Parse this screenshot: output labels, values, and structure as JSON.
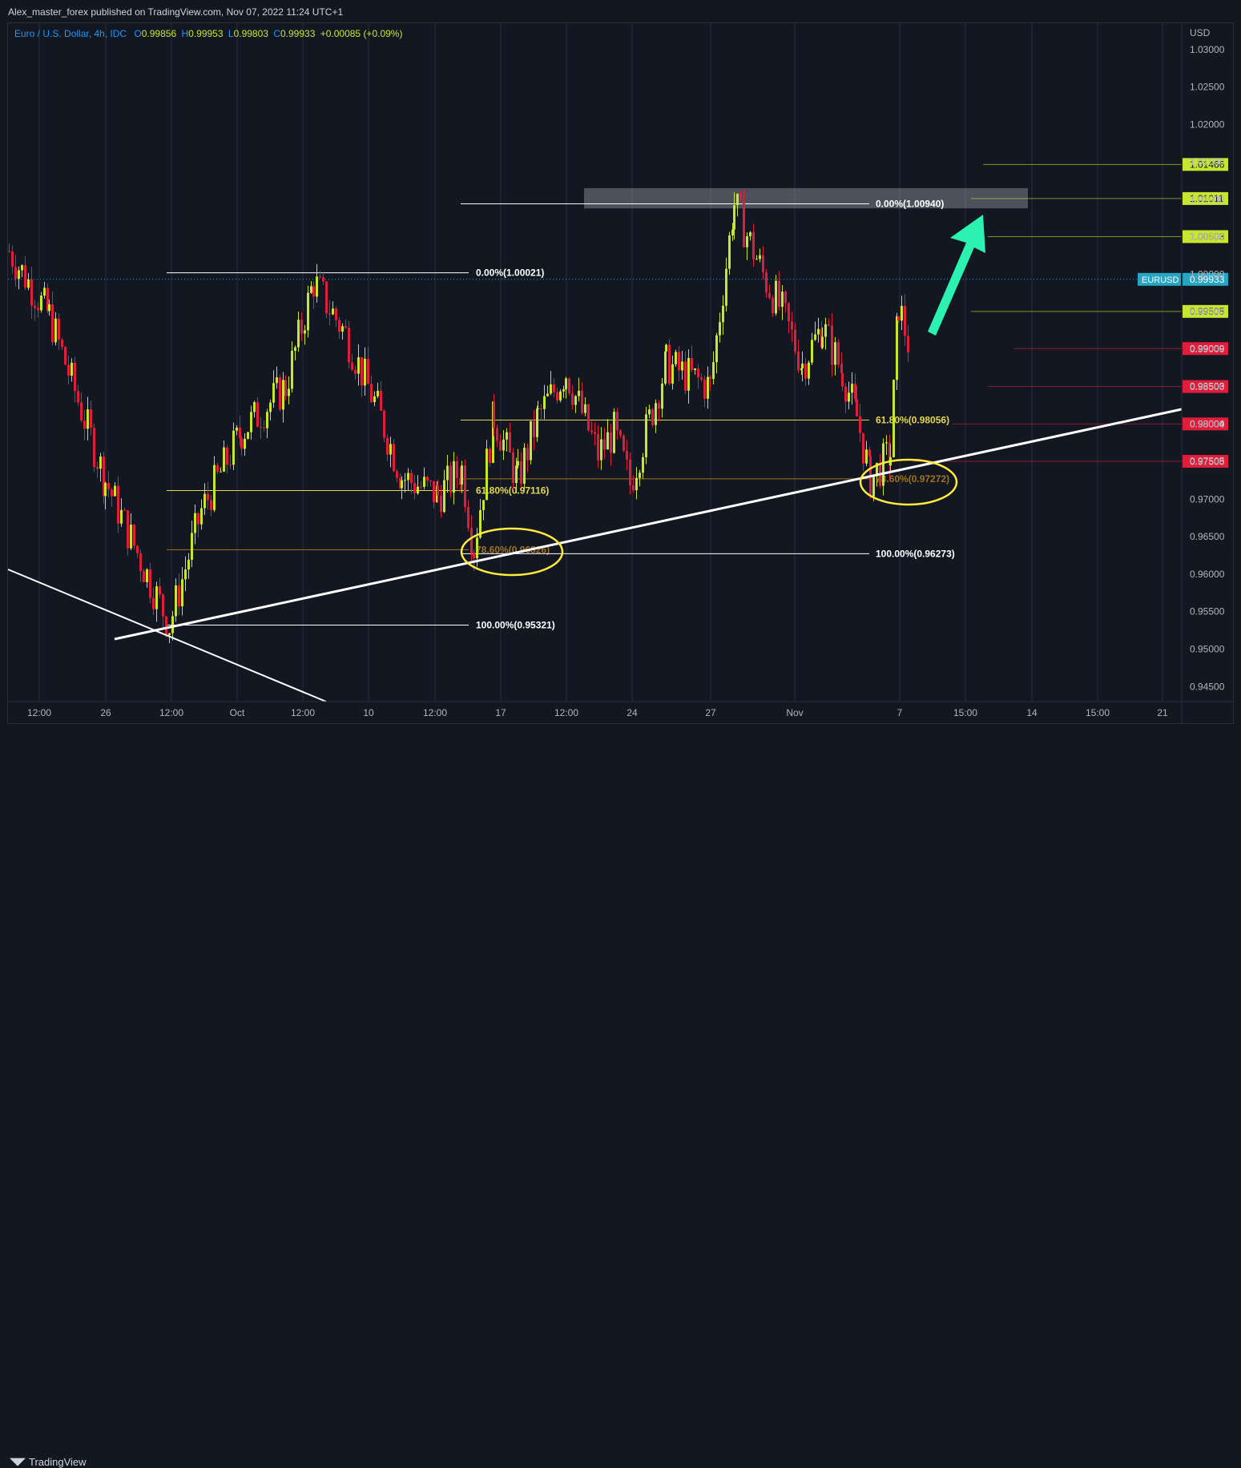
{
  "header": {
    "publisher_line": "Alex_master_forex published on TradingView.com, Nov 07, 2022 11:24 UTC+1"
  },
  "legend": {
    "symbol": "Euro / U.S. Dollar, 4h, IDC",
    "o_label": "O",
    "o_value": "0.99856",
    "h_label": "H",
    "h_value": "0.99953",
    "l_label": "L",
    "l_value": "0.99803",
    "c_label": "C",
    "c_value": "0.99933",
    "change": "+0.00085 (+0.09%)"
  },
  "footer": {
    "brand": "TradingView"
  },
  "colors": {
    "background": "#131722",
    "up": "#c8e62f",
    "down": "#e01e3c",
    "fib_white": "#ffffff",
    "fib_yellow": "#e6d84a",
    "fib_orange": "#a0741e",
    "target_green": "#c8e62f",
    "target_red": "#e01e3c",
    "arrow": "#2bf2b0",
    "last_price_label": "#26a6c2"
  },
  "chart_data": {
    "type": "candlestick",
    "currency_label": "USD",
    "ylim": [
      0.943,
      1.0335
    ],
    "y_ticks": [
      "1.03000",
      "1.02500",
      "1.02000",
      "1.01500",
      "1.01000",
      "1.00500",
      "1.00000",
      "0.99500",
      "0.99000",
      "0.98500",
      "0.98000",
      "0.97500",
      "0.97000",
      "0.96500",
      "0.96000",
      "0.95500",
      "0.95000",
      "0.94500"
    ],
    "x_ticks": [
      "12:00",
      "26",
      "12:00",
      "Oct",
      "12:00",
      "10",
      "12:00",
      "17",
      "12:00",
      "24",
      "27",
      "Nov",
      "7",
      "15:00",
      "14",
      "15:00",
      "21"
    ],
    "last_price": {
      "symbol": "EURUSD",
      "value": "0.99933"
    },
    "price_targets": [
      {
        "label": "1.01466",
        "price": 1.01466,
        "kind": "green"
      },
      {
        "label": "1.01011",
        "price": 1.01011,
        "kind": "green"
      },
      {
        "label": "1.00503",
        "price": 1.00503,
        "kind": "green"
      },
      {
        "label": "0.99505",
        "price": 0.99505,
        "kind": "green"
      },
      {
        "label": "0.99009",
        "price": 0.99009,
        "kind": "red"
      },
      {
        "label": "0.98503",
        "price": 0.98503,
        "kind": "red"
      },
      {
        "label": "0.98004",
        "price": 0.98004,
        "kind": "red"
      },
      {
        "label": "0.97505",
        "price": 0.97505,
        "kind": "red"
      }
    ],
    "fib_levels": [
      {
        "label": "0.00%(1.00021)",
        "price": 1.00021,
        "style": "white"
      },
      {
        "label": "61.80%(0.97116)",
        "price": 0.97116,
        "style": "yellow"
      },
      {
        "label": "78.60%(0.96326)",
        "price": 0.96326,
        "style": "orange"
      },
      {
        "label": "100.00%(0.95321)",
        "price": 0.95321,
        "style": "white"
      },
      {
        "label": "0.00%(1.00940)",
        "price": 1.0094,
        "style": "white"
      },
      {
        "label": "61.80%(0.98056)",
        "price": 0.98056,
        "style": "yellow"
      },
      {
        "label": "78.60%(0.97272)",
        "price": 0.97272,
        "style": "orange"
      },
      {
        "label": "100.00%(0.96273)",
        "price": 0.96273,
        "style": "white"
      }
    ],
    "resistance_zone": {
      "low": 1.0088,
      "high": 1.0115
    },
    "anchors": [
      {
        "price": 1.0031,
        "close": 0.9995
      },
      {
        "price": 0.9945,
        "close": 0.985
      },
      {
        "price": 0.9725,
        "close": 0.9625
      },
      {
        "price": 0.9532,
        "close": 0.9532
      },
      {
        "price": 0.9685,
        "close": 0.9815
      },
      {
        "price": 0.979,
        "close": 0.984
      },
      {
        "price": 0.985,
        "close": 0.999
      },
      {
        "price": 0.999,
        "close": 0.992
      },
      {
        "price": 0.992,
        "close": 0.982
      },
      {
        "price": 0.982,
        "close": 0.973
      },
      {
        "price": 0.973,
        "close": 0.9705
      },
      {
        "price": 0.9705,
        "close": 0.974
      },
      {
        "price": 0.974,
        "close": 0.9635
      },
      {
        "price": 0.9635,
        "close": 0.981
      },
      {
        "price": 0.981,
        "close": 0.9725
      },
      {
        "price": 0.9725,
        "close": 0.981
      },
      {
        "price": 0.981,
        "close": 0.987
      },
      {
        "price": 0.987,
        "close": 0.976
      },
      {
        "price": 0.976,
        "close": 0.979
      },
      {
        "price": 0.979,
        "close": 0.972
      },
      {
        "price": 0.972,
        "close": 0.988
      },
      {
        "price": 0.988,
        "close": 0.985
      },
      {
        "price": 0.985,
        "close": 1.0094
      },
      {
        "price": 1.0094,
        "close": 0.999
      },
      {
        "price": 0.999,
        "close": 0.995
      },
      {
        "price": 0.995,
        "close": 0.988
      },
      {
        "price": 0.988,
        "close": 0.993
      },
      {
        "price": 0.993,
        "close": 0.987
      },
      {
        "price": 0.987,
        "close": 0.981
      },
      {
        "price": 0.981,
        "close": 0.9727
      },
      {
        "price": 0.9727,
        "close": 0.976
      },
      {
        "price": 0.976,
        "close": 0.996
      },
      {
        "price": 0.996,
        "close": 0.9905
      },
      {
        "price": 0.9905,
        "close": 0.9993
      }
    ]
  }
}
